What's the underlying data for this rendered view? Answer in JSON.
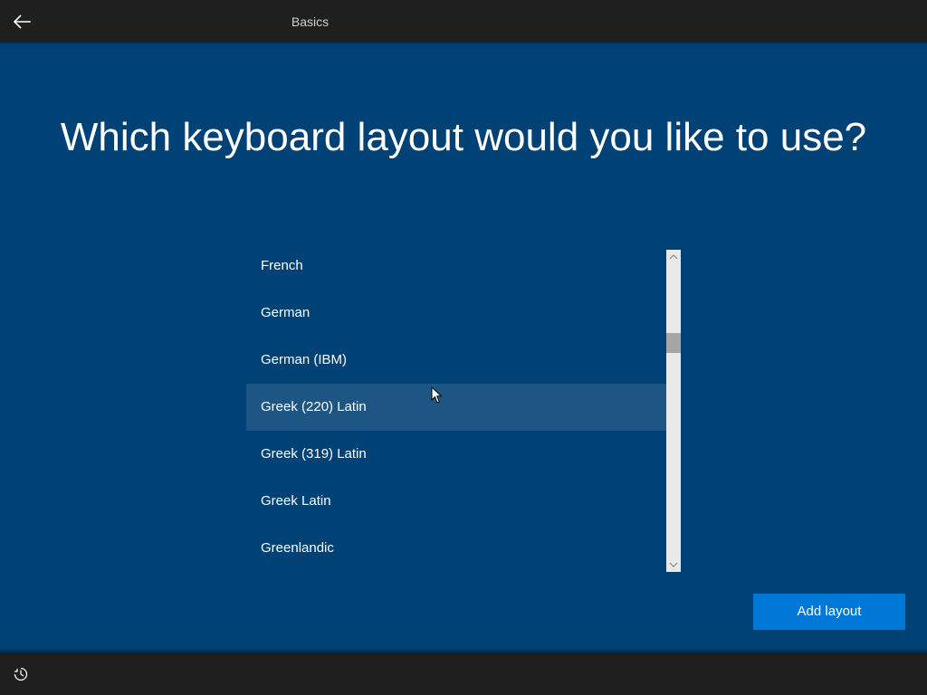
{
  "header": {
    "back_icon": "arrow-left-icon",
    "tab_label": "Basics"
  },
  "main": {
    "title": "Which keyboard layout would you like to use?",
    "layouts": [
      {
        "label": "French",
        "state": "normal"
      },
      {
        "label": "German",
        "state": "normal"
      },
      {
        "label": "German (IBM)",
        "state": "normal"
      },
      {
        "label": "Greek (220) Latin",
        "state": "hovered"
      },
      {
        "label": "Greek (319) Latin",
        "state": "normal"
      },
      {
        "label": "Greek Latin",
        "state": "normal"
      },
      {
        "label": "Greenlandic",
        "state": "normal"
      }
    ],
    "add_button_label": "Add layout"
  },
  "footer": {
    "accessibility_icon": "ease-of-access-icon"
  },
  "colors": {
    "background": "#004275",
    "bar": "#1f1f1f",
    "accent_button": "#0078d7",
    "hover_row": "#1d5685"
  }
}
